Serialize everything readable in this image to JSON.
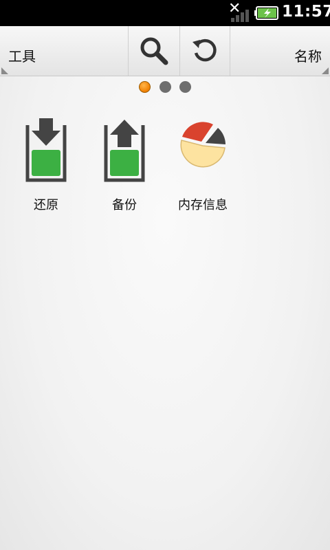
{
  "status_bar": {
    "close_glyph": "✕",
    "time": "11:57",
    "icons": [
      "close-icon",
      "signal-icon",
      "battery-charging-icon"
    ]
  },
  "toolbar": {
    "left_label": "工具",
    "right_label": "名称",
    "search_icon": "search-icon",
    "refresh_icon": "refresh-icon"
  },
  "pager": {
    "page_count": 3,
    "current_page": 1
  },
  "apps": [
    {
      "label": "还原",
      "icon": "restore-icon"
    },
    {
      "label": "备份",
      "icon": "backup-icon"
    },
    {
      "label": "内存信息",
      "icon": "pie-chart-icon"
    }
  ],
  "colors": {
    "accent_orange": "#f08a00",
    "green": "#3cb043",
    "dark_gray": "#444444",
    "pie_red": "#d9432e",
    "pie_yellow": "#fde3a0"
  }
}
